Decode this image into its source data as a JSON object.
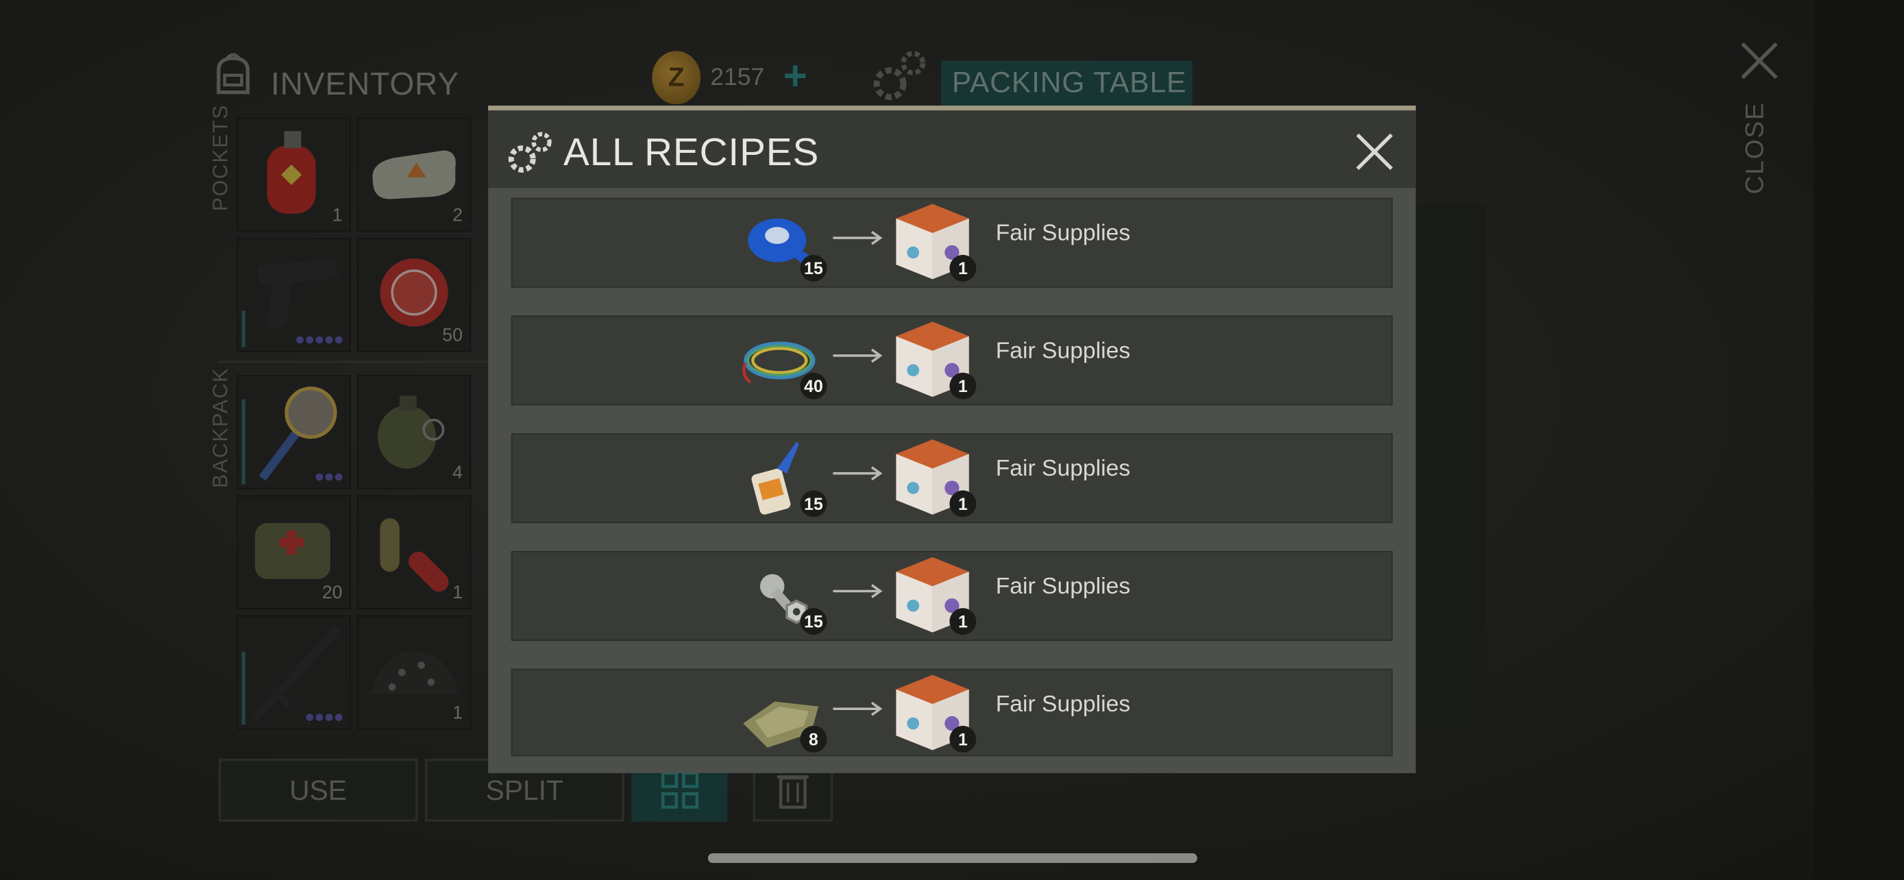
{
  "inventory": {
    "title": "INVENTORY",
    "pockets_label": "POCKETS",
    "backpack_label": "BACKPACK",
    "pocket_slots": [
      {
        "item": "gas-canister",
        "count": "1"
      },
      {
        "item": "explosive-pack",
        "count": "2"
      },
      {
        "item": "pistol",
        "count": ""
      },
      {
        "item": "bottle-cap",
        "count": "50"
      }
    ],
    "backpack_slots": [
      {
        "item": "saw-mace",
        "count": ""
      },
      {
        "item": "grenade",
        "count": "4"
      },
      {
        "item": "medkit-bag",
        "count": "20"
      },
      {
        "item": "pills",
        "count": "1"
      },
      {
        "item": "assault-rifle",
        "count": ""
      },
      {
        "item": "gravel",
        "count": "1"
      }
    ],
    "buttons": {
      "use": "USE",
      "split": "SPLIT"
    }
  },
  "topbar": {
    "currency_symbol": "Z",
    "coins": "2157",
    "plus": "+",
    "station": "PACKING TABLE",
    "close_label": "CLOSE"
  },
  "modal": {
    "title": "ALL RECIPES",
    "recipes": [
      {
        "ingredient": "blue-tape",
        "ingredient_count": "15",
        "result_count": "1",
        "result_name": "Fair Supplies"
      },
      {
        "ingredient": "wires",
        "ingredient_count": "40",
        "result_count": "1",
        "result_name": "Fair Supplies"
      },
      {
        "ingredient": "glue",
        "ingredient_count": "15",
        "result_count": "1",
        "result_name": "Fair Supplies"
      },
      {
        "ingredient": "bolts-nuts",
        "ingredient_count": "15",
        "result_count": "1",
        "result_name": "Fair Supplies"
      },
      {
        "ingredient": "cloth",
        "ingredient_count": "8",
        "result_count": "1",
        "result_name": "Fair Supplies"
      }
    ]
  },
  "colors": {
    "accent_teal": "#1e4e4a",
    "modal_bg": "#4d4f4a",
    "modal_border": "#a09a83"
  }
}
